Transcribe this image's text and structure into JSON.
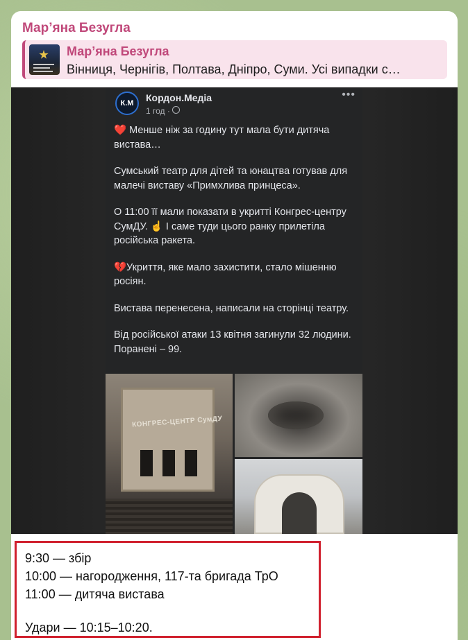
{
  "message": {
    "sender": "Мар’яна Безугла",
    "reply": {
      "title": "Мар’яна Безугла",
      "text": "Вінниця, Чернігів, Полтава, Дніпро, Суми. Усі випадки с…"
    },
    "post": {
      "page_name": "Кордон.Медіа",
      "avatar_text": "К.М",
      "time": "1 год ·",
      "more": "•••",
      "paragraphs": [
        "❤️ Менше ніж за годину тут мала бути дитяча вистава…",
        "Сумський театр для дітей та юнацтва готував для малечі виставу «Примхлива принцеса».",
        "О 11:00 її мали показати в укритті Конгрес-центру СумДУ. ☝️ І саме туди цього ранку прилетіла російська ракета.",
        "💔Укриття, яке мало захистити, стало мішенню росіян.",
        "Вистава перенесена, написали на сторінці театру.",
        "Від російської атаки 13 квітня загинули 32 людини. Поранені – 99."
      ],
      "photo_sign": "КОНГРЕС-ЦЕНТР СумДУ"
    },
    "caption": [
      "9:30 — збір",
      "10:00 — нагородження, 117-та бригада ТрО",
      "11:00 — дитяча вистава",
      "",
      "Удари — 10:15–10:20."
    ]
  },
  "colors": {
    "accent": "#c0487a",
    "highlight_border": "#d0202e"
  }
}
